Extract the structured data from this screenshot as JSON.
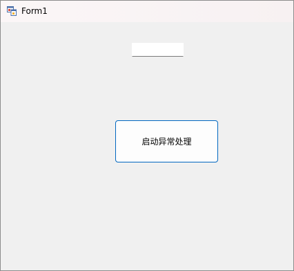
{
  "window": {
    "title": "Form1",
    "icon": "winforms-app-icon"
  },
  "form": {
    "textbox_value": "",
    "button_label": "启动异常处理"
  },
  "colors": {
    "button_border_accent": "#0067c0",
    "client_background": "#f0f0f0"
  }
}
